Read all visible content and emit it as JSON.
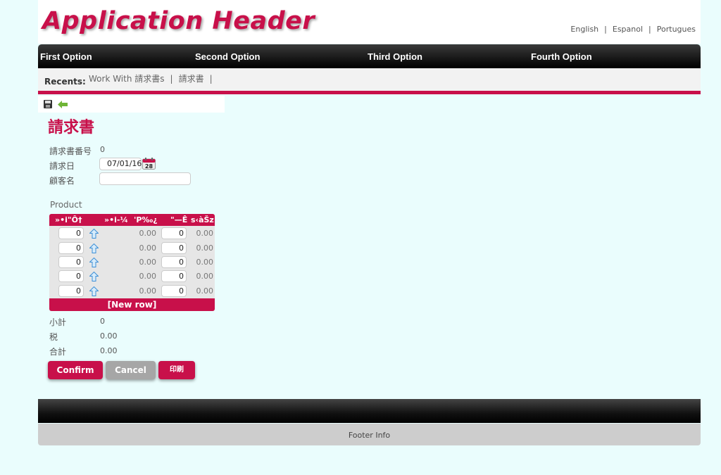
{
  "header": {
    "title": "Application Header",
    "languages": [
      "English",
      "Espanol",
      "Portugues"
    ]
  },
  "nav": {
    "items": [
      "First Option",
      "Second Option",
      "Third Option",
      "Fourth Option"
    ]
  },
  "recents": {
    "label": "Recents:",
    "items": [
      "Work With 請求書s",
      "請求書"
    ]
  },
  "toolbar": {
    "save_icon": "save-icon",
    "back_icon": "back-arrow-icon"
  },
  "form": {
    "title": "請求書",
    "invoice_number_label": "請求書番号",
    "invoice_number_value": "0",
    "invoice_date_label": "請求日",
    "invoice_date_value": "07/01/16",
    "customer_name_label": "顧客名",
    "customer_name_value": "",
    "calendar_icon_day": "28"
  },
  "product": {
    "label": "Product",
    "columns": [
      "»•i\"Ô†",
      "»•i-¼",
      "'P‰¿",
      "\"—Ê",
      "s‹àŠz"
    ],
    "rows": [
      {
        "product_id": "0",
        "price": "0.00",
        "quantity": "0",
        "amount": "0.00"
      },
      {
        "product_id": "0",
        "price": "0.00",
        "quantity": "0",
        "amount": "0.00"
      },
      {
        "product_id": "0",
        "price": "0.00",
        "quantity": "0",
        "amount": "0.00"
      },
      {
        "product_id": "0",
        "price": "0.00",
        "quantity": "0",
        "amount": "0.00"
      },
      {
        "product_id": "0",
        "price": "0.00",
        "quantity": "0",
        "amount": "0.00"
      }
    ],
    "new_row_label": "[New row]"
  },
  "summary": {
    "subtotal_label": "小計",
    "subtotal_value": "0",
    "tax_label": "税",
    "tax_value": "0.00",
    "total_label": "合計",
    "total_value": "0.00"
  },
  "buttons": {
    "confirm": "Confirm",
    "cancel": "Cancel",
    "print": "印刷"
  },
  "footer": {
    "info": "Footer Info"
  },
  "colors": {
    "accent": "#c8104a",
    "background": "#eafdfd",
    "cancel": "#a6a6a6"
  }
}
